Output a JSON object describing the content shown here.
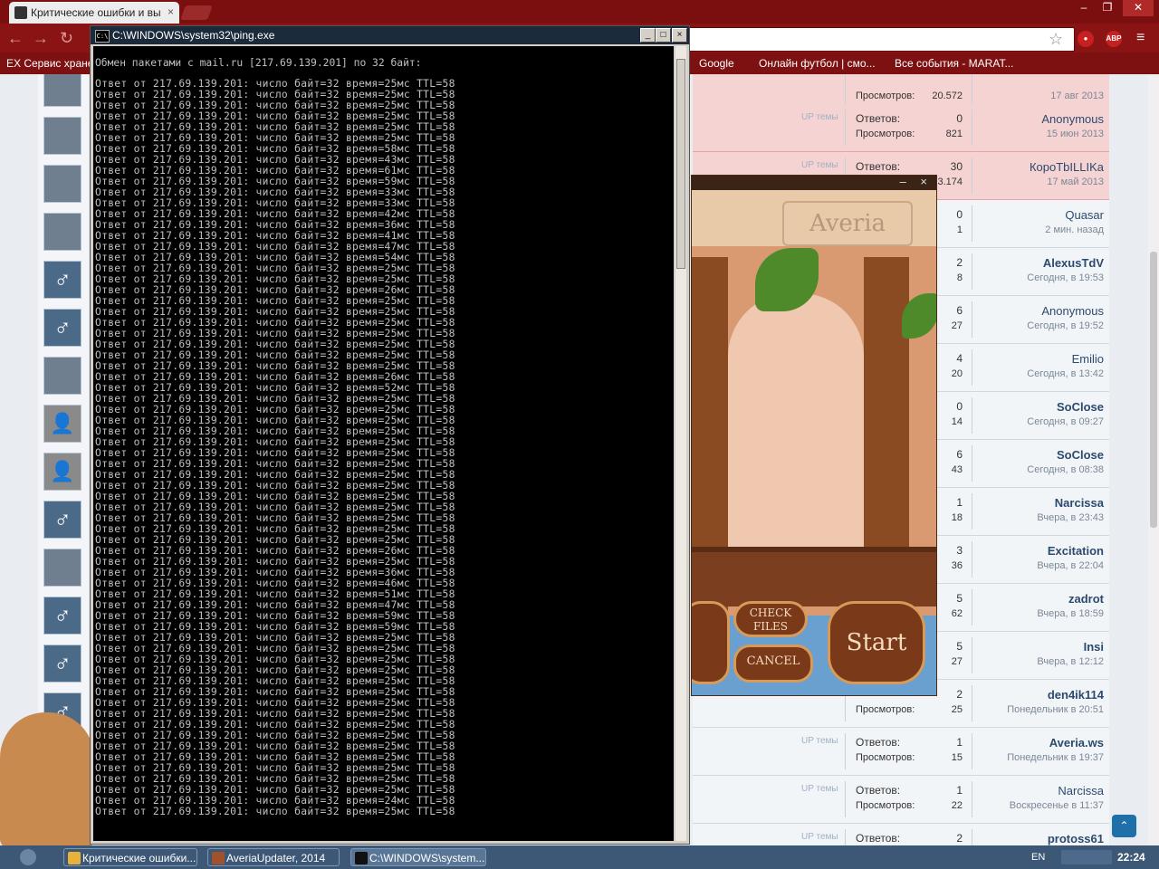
{
  "browser": {
    "tab_title": "Критические ошибки и вы",
    "tab_close": "×",
    "window_controls": [
      "‒",
      "❐",
      "✕"
    ],
    "bookmarks": [
      {
        "label": "EX Сервис хране",
        "x": "7"
      },
      {
        "label": "Google"
      },
      {
        "label": "Онлайн футбол | смо..."
      },
      {
        "label": "Все события - MARAT..."
      }
    ],
    "ext_abp": "ABP"
  },
  "console": {
    "title": "C:\\WINDOWS\\system32\\ping.exe",
    "icon_text": "C:\\",
    "buttons": [
      "_",
      "□",
      "×"
    ],
    "header": "Обмен пакетами с mail.ru [217.69.139.201] по 32 байт:",
    "reply_prefix": "Ответ от 217.69.139.201: число байт=32 время=",
    "reply_suffix": " TTL=58",
    "times": [
      25,
      25,
      25,
      25,
      25,
      25,
      58,
      43,
      61,
      59,
      33,
      33,
      42,
      36,
      41,
      47,
      54,
      25,
      25,
      26,
      25,
      25,
      25,
      25,
      25,
      25,
      25,
      26,
      52,
      25,
      25,
      25,
      25,
      25,
      25,
      25,
      25,
      25,
      25,
      25,
      25,
      25,
      25,
      26,
      25,
      36,
      46,
      51,
      47,
      59,
      59,
      25,
      25,
      25,
      25,
      25,
      25,
      25,
      25,
      25,
      25,
      25,
      25,
      25,
      25,
      25,
      24,
      25
    ]
  },
  "forum": {
    "rows": [
      {
        "pink": true,
        "lbl1": "",
        "val1": "",
        "lbl2": "Просмотров:",
        "val2": "20.572",
        "user": "",
        "date": "17 авг 2013",
        "up": "",
        "bold": false
      },
      {
        "pink": true,
        "lbl1": "Ответов:",
        "val1": "0",
        "lbl2": "Просмотров:",
        "val2": "821",
        "user": "Anonymous",
        "date": "15 июн 2013",
        "up": "UP темы",
        "bold": false
      },
      {
        "pink": true,
        "lbl1": "Ответов:",
        "val1": "30",
        "lbl2": "",
        "val2": "3.174",
        "user": "КороТbILLIKa",
        "date": "17 май 2013",
        "up": "UP темы",
        "bold": false
      },
      {
        "pink": false,
        "lbl1": "",
        "val1": "0",
        "lbl2": "",
        "val2": "1",
        "user": "Quasar",
        "date": "2 мин. назад",
        "up": "",
        "bold": false
      },
      {
        "pink": false,
        "lbl1": "",
        "val1": "2",
        "lbl2": "",
        "val2": "8",
        "user": "AlexusTdV",
        "date": "Сегодня, в 19:53",
        "up": "",
        "bold": true
      },
      {
        "pink": false,
        "lbl1": "",
        "val1": "6",
        "lbl2": "",
        "val2": "27",
        "user": "Anonymous",
        "date": "Сегодня, в 19:52",
        "up": "",
        "bold": false
      },
      {
        "pink": false,
        "lbl1": "",
        "val1": "4",
        "lbl2": "",
        "val2": "20",
        "user": "Emilio",
        "date": "Сегодня, в 13:42",
        "up": "",
        "bold": false
      },
      {
        "pink": false,
        "lbl1": "",
        "val1": "0",
        "lbl2": "",
        "val2": "14",
        "user": "SoClose",
        "date": "Сегодня, в 09:27",
        "up": "",
        "bold": true
      },
      {
        "pink": false,
        "lbl1": "",
        "val1": "6",
        "lbl2": "",
        "val2": "43",
        "user": "SoClose",
        "date": "Сегодня, в 08:38",
        "up": "",
        "bold": true
      },
      {
        "pink": false,
        "lbl1": "",
        "val1": "1",
        "lbl2": "",
        "val2": "18",
        "user": "Narcissa",
        "date": "Вчера, в 23:43",
        "up": "",
        "bold": true
      },
      {
        "pink": false,
        "lbl1": "",
        "val1": "3",
        "lbl2": "",
        "val2": "36",
        "user": "Excitation",
        "date": "Вчера, в 22:04",
        "up": "",
        "bold": true
      },
      {
        "pink": false,
        "lbl1": "",
        "val1": "5",
        "lbl2": "",
        "val2": "62",
        "user": "zadrot",
        "date": "Вчера, в 18:59",
        "up": "",
        "bold": true
      },
      {
        "pink": false,
        "lbl1": "",
        "val1": "5",
        "lbl2": "",
        "val2": "27",
        "user": "Insi",
        "date": "Вчера, в 12:12",
        "up": "",
        "bold": true
      },
      {
        "pink": false,
        "lbl1": "",
        "val1": "2",
        "lbl2": "Просмотров:",
        "val2": "25",
        "user": "den4ik114",
        "date": "Понедельник в 20:51",
        "up": "",
        "bold": true
      },
      {
        "pink": false,
        "lbl1": "Ответов:",
        "val1": "1",
        "lbl2": "Просмотров:",
        "val2": "15",
        "user": "Averia.ws",
        "date": "Понедельник в 19:37",
        "up": "UP темы",
        "bold": true
      },
      {
        "pink": false,
        "lbl1": "Ответов:",
        "val1": "1",
        "lbl2": "Просмотров:",
        "val2": "22",
        "user": "Narcissa",
        "date": "Воскресенье в 11:37",
        "up": "UP темы",
        "bold": false
      },
      {
        "pink": false,
        "lbl1": "Ответов:",
        "val1": "2",
        "lbl2": "",
        "val2": "",
        "user": "protoss61",
        "date": "",
        "up": "UP темы",
        "bold": true
      }
    ],
    "avatar_glyph": "♂"
  },
  "averia": {
    "logo": "Averia",
    "controls": "‒ ×",
    "check_files": "CHECK FILES",
    "cancel": "CANCEL",
    "start": "Start"
  },
  "taskbar": {
    "tasks": [
      {
        "label": "Критические ошибки...",
        "color": "#e8b23a"
      },
      {
        "label": "AveriaUpdater, 2014",
        "color": "#a0522d"
      },
      {
        "label": "C:\\WINDOWS\\system...",
        "color": "#111111"
      }
    ],
    "lang": "EN",
    "clock": "22:24"
  }
}
